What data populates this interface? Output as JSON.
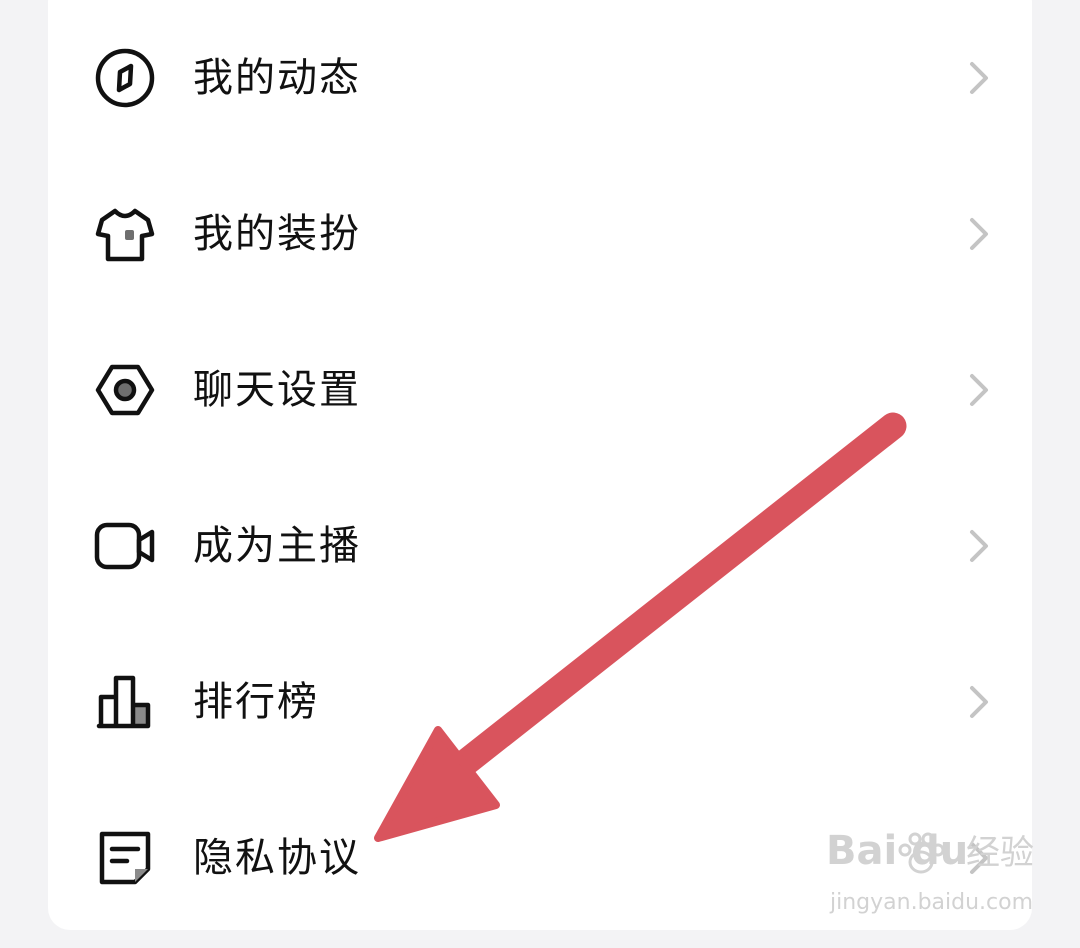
{
  "menu": {
    "items": [
      {
        "label": "我的动态",
        "icon": "compass-icon"
      },
      {
        "label": "我的装扮",
        "icon": "tshirt-icon"
      },
      {
        "label": "聊天设置",
        "icon": "hexagon-settings-icon"
      },
      {
        "label": "成为主播",
        "icon": "video-camera-icon"
      },
      {
        "label": "排行榜",
        "icon": "bar-chart-icon"
      },
      {
        "label": "隐私协议",
        "icon": "document-icon"
      }
    ]
  },
  "annotation": {
    "arrow_color": "#d9545d",
    "arrow_target": "隐私协议"
  },
  "watermark": {
    "brand": "Bai du",
    "sub": "经验",
    "url": "jingyan.baidu.com"
  },
  "colors": {
    "background": "#f3f3f5",
    "card": "#ffffff",
    "text": "#111111",
    "chevron": "#c4c4c4",
    "watermark": "#d2d2d2"
  }
}
